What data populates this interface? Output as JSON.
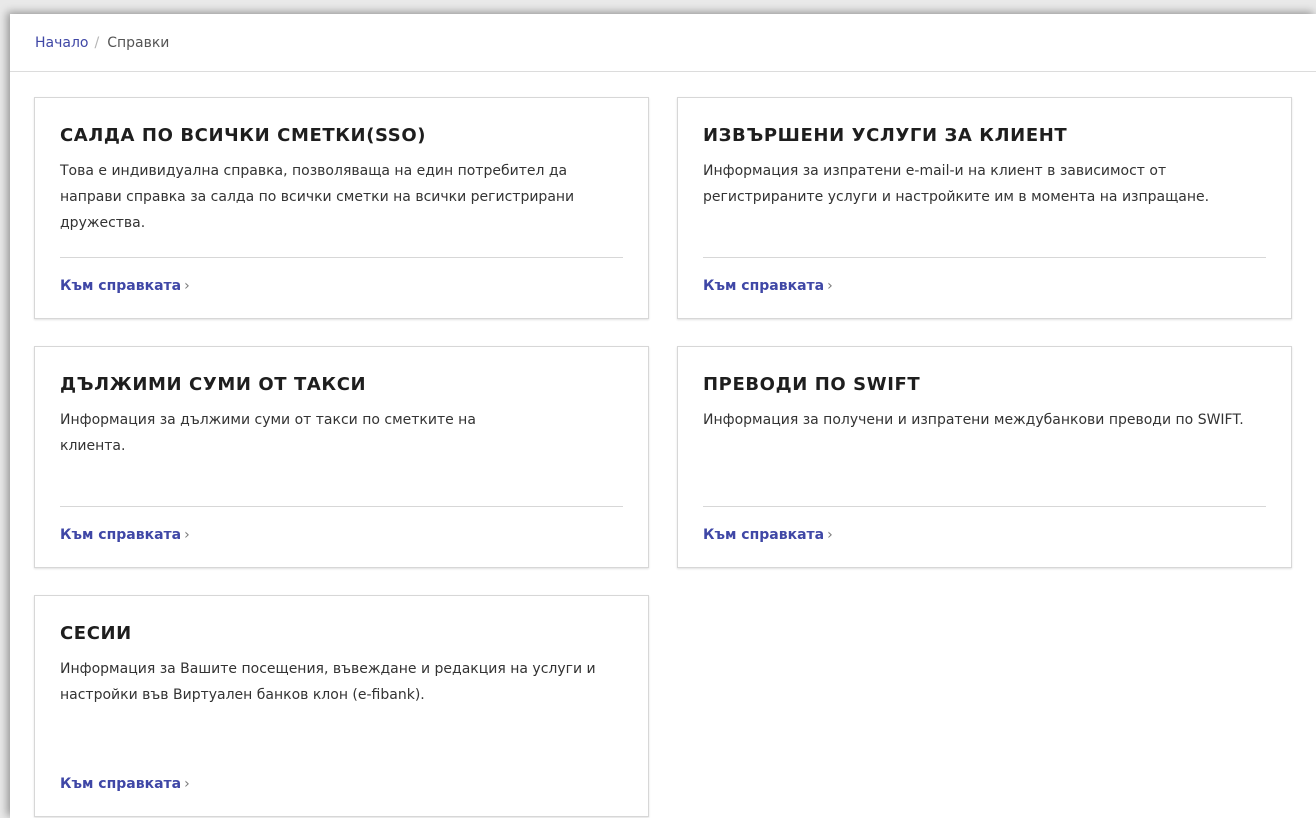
{
  "breadcrumb": {
    "home": "Начало",
    "separator": "/",
    "current": "Справки"
  },
  "cards": [
    {
      "title": "САЛДА ПО ВСИЧКИ СМЕТКИ(SSO)",
      "description": "Това е индивидуална справка, позволяваща на един потребител да направи справка за салда по всички сметки на всички регистрирани дружества.",
      "link": "Към справката",
      "chevron": "›"
    },
    {
      "title": "ИЗВЪРШЕНИ УСЛУГИ ЗА КЛИЕНТ",
      "description": "Информация за изпратени e-mail-и на клиент в зависимост от регистрираните услуги и настройките им в момента на изпращане.",
      "link": "Към справката",
      "chevron": "›"
    },
    {
      "title": "ДЪЛЖИМИ СУМИ ОТ ТАКСИ",
      "description": "Информация за дължими суми от такси по сметките на клиента.",
      "link": "Към справката",
      "chevron": "›"
    },
    {
      "title": "ПРЕВОДИ ПО SWIFT",
      "description": "Информация за получени и изпратени междубанкови преводи по SWIFT.",
      "link": "Към справката",
      "chevron": "›"
    },
    {
      "title": "СЕСИИ",
      "description": "Информация за Вашите посещения, въвеждане и редакция на услуги и настройки във Виртуален банков клон (e-fibank).",
      "link": "Към справката",
      "chevron": "›"
    }
  ]
}
